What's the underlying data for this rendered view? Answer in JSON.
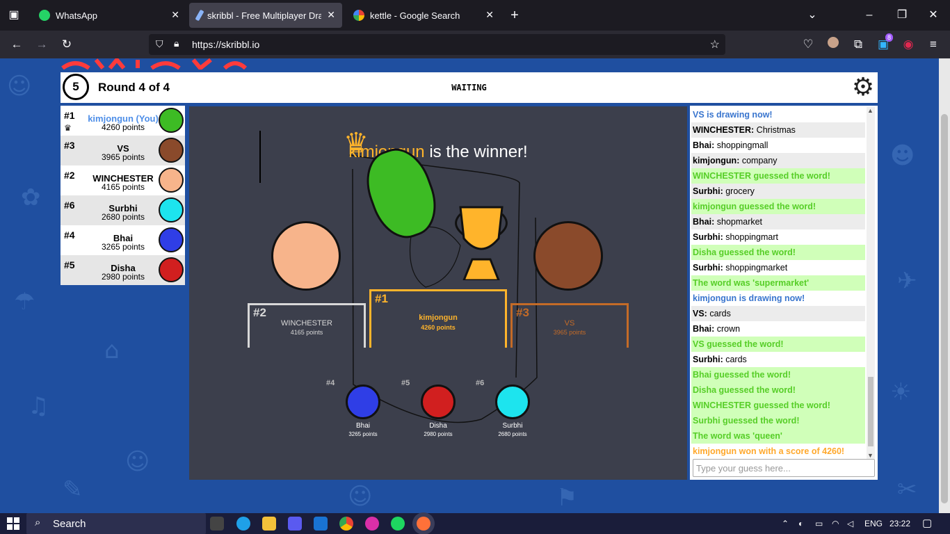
{
  "browser": {
    "tabs": [
      {
        "label": "WhatsApp",
        "icon": "whatsapp-icon"
      },
      {
        "label": "skribbl - Free Multiplayer Drawing & Guessing Game",
        "icon": "skribbl-icon",
        "active": true
      },
      {
        "label": "kettle - Google Search",
        "icon": "google-icon"
      }
    ],
    "url": "https://skribbl.io",
    "extension_badge": "8"
  },
  "game": {
    "timer": "5",
    "round": "Round 4 of 4",
    "status": "WAITING"
  },
  "players": [
    {
      "rank": "#1",
      "name": "kimjongun (You)",
      "points": "4260 points",
      "color": "#3dbb24",
      "me": true
    },
    {
      "rank": "#3",
      "name": "VS",
      "points": "3965 points",
      "color": "#8a4a2b"
    },
    {
      "rank": "#2",
      "name": "WINCHESTER",
      "points": "4165 points",
      "color": "#f7b48b"
    },
    {
      "rank": "#6",
      "name": "Surbhi",
      "points": "2680 points",
      "color": "#1de4ee"
    },
    {
      "rank": "#4",
      "name": "Bhai",
      "points": "3265 points",
      "color": "#2f3ee6"
    },
    {
      "rank": "#5",
      "name": "Disha",
      "points": "2980 points",
      "color": "#d11f1f"
    }
  ],
  "results": {
    "winner_name": "kimjongun",
    "winner_suffix": " is the winner!",
    "podium": [
      {
        "rank": "#2",
        "name": "WINCHESTER",
        "points": "4165 points"
      },
      {
        "rank": "#1",
        "name": "kimjongun",
        "points": "4260 points"
      },
      {
        "rank": "#3",
        "name": "VS",
        "points": "3965 points"
      }
    ],
    "others": [
      {
        "rank": "#4",
        "name": "Bhai",
        "points": "3265 points"
      },
      {
        "rank": "#5",
        "name": "Disha",
        "points": "2980 points"
      },
      {
        "rank": "#6",
        "name": "Surbhi",
        "points": "2680 points"
      }
    ]
  },
  "chat": {
    "messages": [
      {
        "type": "blue",
        "text": "VS is drawing now!"
      },
      {
        "type": "normal",
        "author": "WINCHESTER:",
        "text": " Christmas"
      },
      {
        "type": "normal",
        "author": "Bhai:",
        "text": " shoppingmall"
      },
      {
        "type": "normal",
        "author": "kimjongun:",
        "text": " company"
      },
      {
        "type": "green",
        "text": "WINCHESTER guessed the word!"
      },
      {
        "type": "normal",
        "author": "Surbhi:",
        "text": " grocery"
      },
      {
        "type": "green",
        "text": "kimjongun guessed the word!"
      },
      {
        "type": "normal",
        "author": "Bhai:",
        "text": " shopmarket"
      },
      {
        "type": "normal",
        "author": "Surbhi:",
        "text": " shoppingmart"
      },
      {
        "type": "green",
        "text": "Disha guessed the word!"
      },
      {
        "type": "normal",
        "author": "Surbhi:",
        "text": " shoppingmarket"
      },
      {
        "type": "green",
        "text": "The word was 'supermarket'"
      },
      {
        "type": "blue",
        "text": "kimjongun is drawing now!"
      },
      {
        "type": "normal",
        "author": "VS:",
        "text": " cards"
      },
      {
        "type": "normal",
        "author": "Bhai:",
        "text": " crown"
      },
      {
        "type": "green",
        "text": "VS guessed the word!"
      },
      {
        "type": "normal",
        "author": "Surbhi:",
        "text": " cards"
      },
      {
        "type": "green",
        "text": "Bhai guessed the word!"
      },
      {
        "type": "green",
        "text": "Disha guessed the word!"
      },
      {
        "type": "green",
        "text": "WINCHESTER guessed the word!"
      },
      {
        "type": "green",
        "text": "Surbhi guessed the word!"
      },
      {
        "type": "green",
        "text": "The word was 'queen'"
      },
      {
        "type": "orange",
        "text": "kimjongun won with a score of 4260!"
      }
    ],
    "input_placeholder": "Type your guess here..."
  },
  "taskbar": {
    "search_label": "Search",
    "language": "ENG",
    "time": "23:22"
  },
  "colors": {
    "background": "#1f4fa0",
    "canvas": "#3c3f4c",
    "gold": "#ffb42b",
    "silver": "#d8d8d8",
    "bronze": "#c46b27",
    "chat_green": "#56ce27",
    "chat_blue": "#3975ce"
  }
}
